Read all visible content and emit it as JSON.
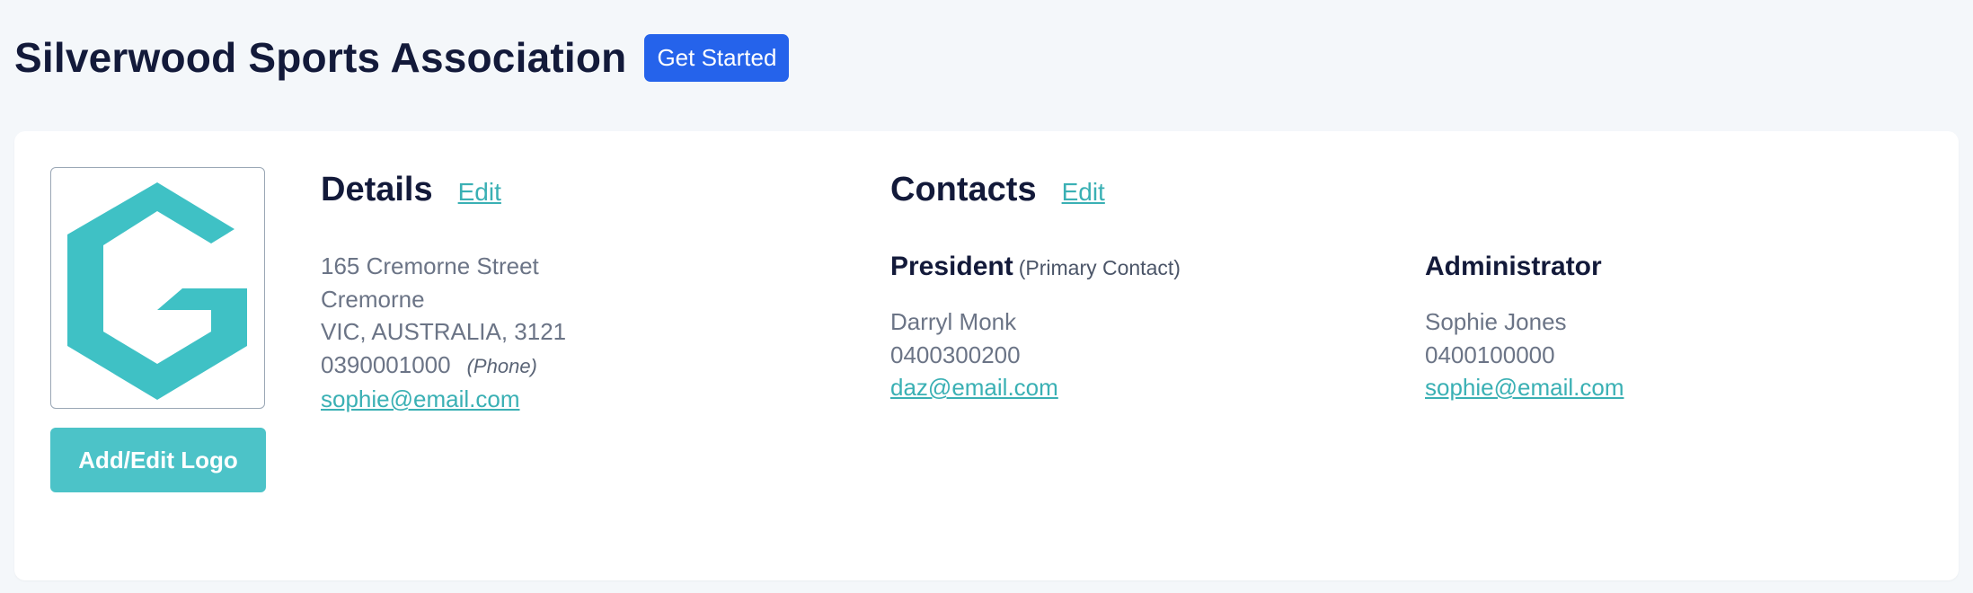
{
  "header": {
    "title": "Silverwood Sports Association",
    "get_started_label": "Get Started"
  },
  "logo": {
    "icon": "association-logo-icon",
    "brand_color": "#3fc1c5",
    "button_label": "Add/Edit Logo"
  },
  "details": {
    "title": "Details",
    "edit_label": "Edit",
    "address_line1": "165 Cremorne Street",
    "address_line2": "Cremorne",
    "address_line3": "VIC,  AUSTRALIA,  3121",
    "phone": "0390001000",
    "phone_note": "(Phone)",
    "email": "sophie@email.com"
  },
  "contacts": {
    "title": "Contacts",
    "edit_label": "Edit",
    "people": [
      {
        "role": "President",
        "note": "(Primary Contact)",
        "name": "Darryl Monk",
        "phone": "0400300200",
        "email": "daz@email.com"
      },
      {
        "role": "Administrator",
        "note": "",
        "name": "Sophie Jones",
        "phone": "0400100000",
        "email": "sophie@email.com"
      }
    ]
  },
  "colors": {
    "accent": "#2563eb",
    "teal": "#3ab0b4",
    "background": "#f4f7fa"
  }
}
